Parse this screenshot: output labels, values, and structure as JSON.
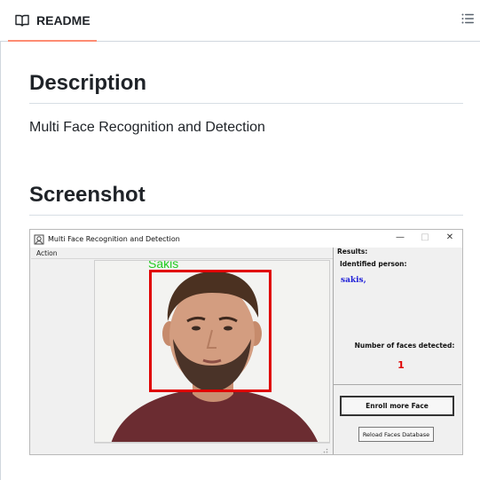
{
  "readme_header": {
    "tab_label": "README",
    "tab_icon": "book-icon",
    "outline_icon": "list-unordered-icon",
    "accent_color": "#fd8c73"
  },
  "content": {
    "description_heading": "Description",
    "description_text": "Multi Face Recognition and Detection",
    "screenshot_heading": "Screenshot"
  },
  "screenshot": {
    "window_title": "Multi Face Recognition and Detection",
    "window_controls": {
      "minimize": "—",
      "maximize": "□",
      "close": "✕"
    },
    "menu": {
      "action": "Action"
    },
    "detected_face_label": "Sakis",
    "results": {
      "title": "Results:",
      "identified_label": "Identified person:",
      "identified_value": "sakis,",
      "count_label": "Number of faces detected:",
      "count_value": "1",
      "enroll_button": "Enroll more Face",
      "reload_button": "Reload Faces Database"
    },
    "colors": {
      "face_box": "#e00000",
      "face_label": "#22cc22",
      "identified_name": "#2323d8",
      "count": "#e00000"
    }
  }
}
